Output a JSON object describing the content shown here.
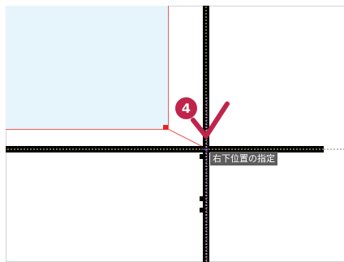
{
  "canvas": {
    "tooltip": "右下位置の指定",
    "step_number": "4"
  },
  "colors": {
    "selection_fill": "#e6f5fb",
    "selection_border": "#f15a5a",
    "handle": "#e82222",
    "badge": "#c0244a",
    "checkmark": "#c0244a",
    "tooltip_bg": "#5d5d5d",
    "guide_yellow": "#e9e57a",
    "guide_purple": "#9a5fd0"
  },
  "icons": {
    "step_badge": "number-circle",
    "confirm": "checkmark-icon"
  }
}
